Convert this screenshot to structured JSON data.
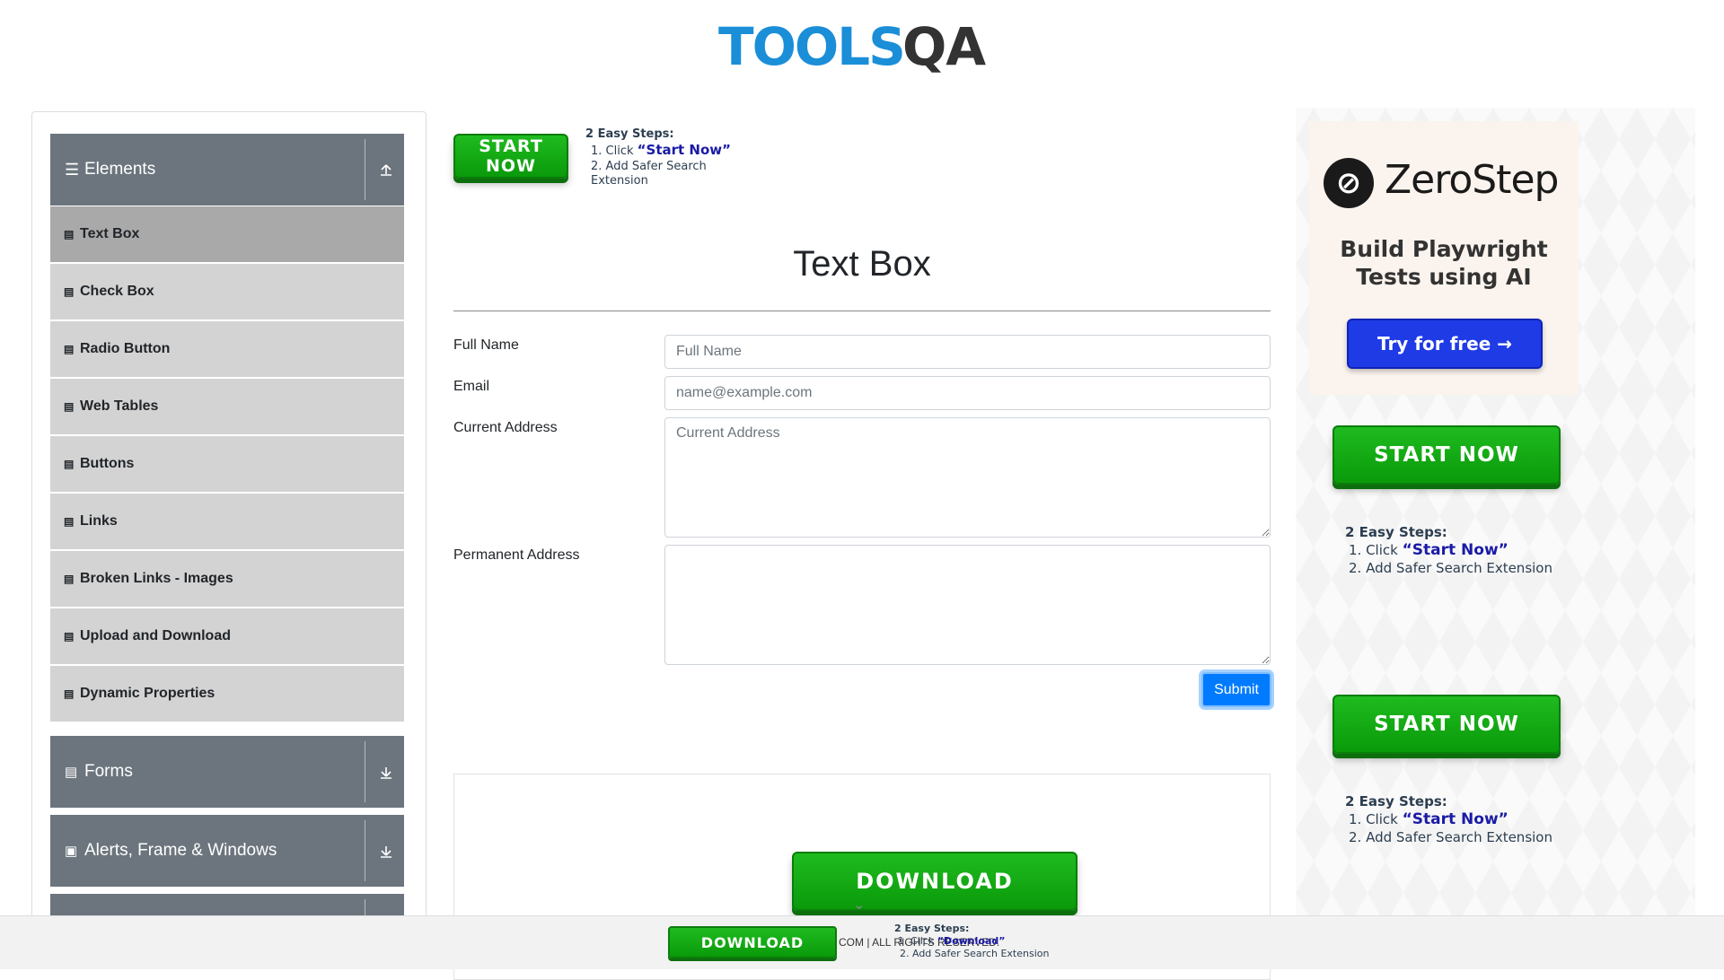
{
  "header": {
    "logo_tools": "TOOLS",
    "logo_qa": "QA"
  },
  "sidebar": {
    "groups": [
      {
        "label": "Elements",
        "icon": "hamburger-icon",
        "toggle": "collapse-icon",
        "items": [
          {
            "label": "Text Box",
            "active": true
          },
          {
            "label": "Check Box"
          },
          {
            "label": "Radio Button"
          },
          {
            "label": "Web Tables"
          },
          {
            "label": "Buttons"
          },
          {
            "label": "Links"
          },
          {
            "label": "Broken Links - Images"
          },
          {
            "label": "Upload and Download"
          },
          {
            "label": "Dynamic Properties"
          }
        ]
      },
      {
        "label": "Forms",
        "icon": "form-icon",
        "toggle": "expand-icon"
      },
      {
        "label": "Alerts, Frame & Windows",
        "icon": "window-icon",
        "toggle": "expand-icon"
      }
    ]
  },
  "top_ad": {
    "button": "START NOW",
    "steps_title": "2 Easy Steps:",
    "step1_prefix": "1. Click ",
    "step1_link": "“Start Now”",
    "step2": "2. Add Safer Search Extension"
  },
  "main": {
    "title": "Text Box",
    "form": {
      "full_name_label": "Full Name",
      "full_name_placeholder": "Full Name",
      "email_label": "Email",
      "email_placeholder": "name@example.com",
      "current_address_label": "Current Address",
      "current_address_placeholder": "Current Address",
      "permanent_address_label": "Permanent Address",
      "permanent_address_placeholder": "",
      "submit": "Submit"
    },
    "download_ad": {
      "button": "DOWNLOAD"
    }
  },
  "right_ad": {
    "zerostep": {
      "brand": "ZeroStep",
      "tagline_line1": "Build Playwright",
      "tagline_line2": "Tests using AI",
      "cta": "Try for free →"
    },
    "ads": [
      {
        "button": "START NOW",
        "steps_title": "2 Easy Steps:",
        "step1_prefix": "1. Click ",
        "step1_link": "“Start Now”",
        "step2": "2. Add Safer Search Extension"
      },
      {
        "button": "START NOW",
        "steps_title": "2 Easy Steps:",
        "step1_prefix": "1. Click ",
        "step1_link": "“Start Now”",
        "step2": "2. Add Safer Search Extension"
      }
    ]
  },
  "bottom_bar": {
    "button": "DOWNLOAD",
    "steps_title": "2 Easy Steps:",
    "step1_prefix": "1. Click ",
    "step1_link": "“Download”",
    "step2": "2. Add Safer Search Extension",
    "footer_text": "COM | ALL RIGHTS RESERVED."
  },
  "colors": {
    "brand_blue": "#1b8ed8",
    "sidebar_header": "#6c757d",
    "active_item": "#a9a9a9",
    "submit": "#007bff",
    "ad_green": "#0a9a0a"
  }
}
